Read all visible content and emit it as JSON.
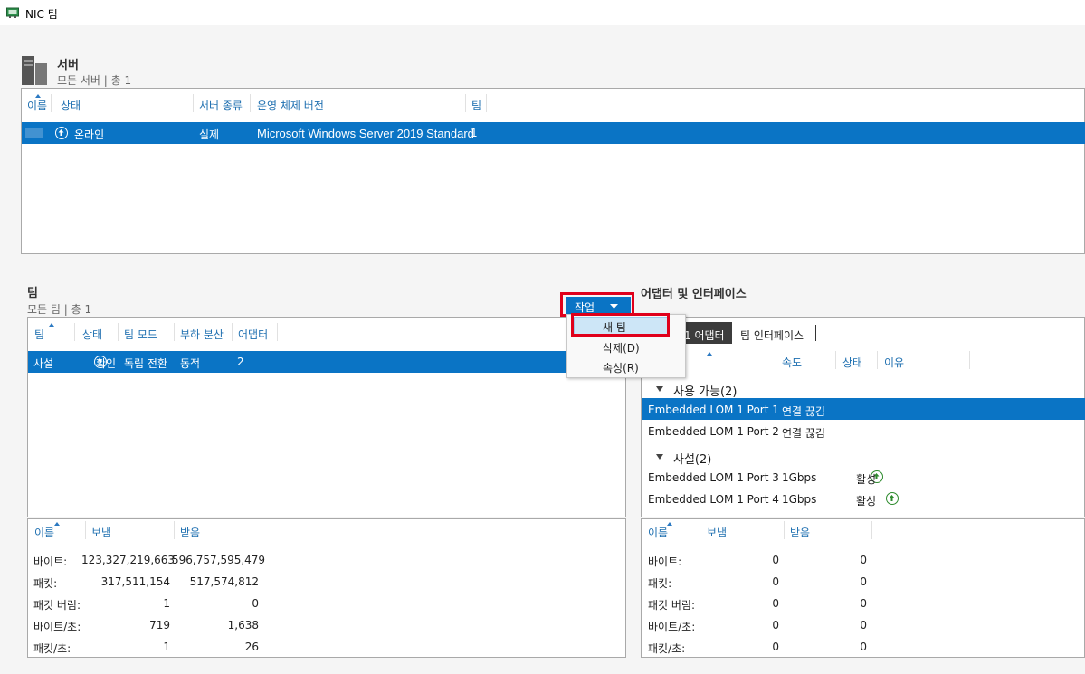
{
  "window": {
    "title": "NIC 팀"
  },
  "servers": {
    "title": "서버",
    "subtitle": "모든 서버 | 총 1",
    "columns": [
      "이름",
      "상태",
      "서버 종류",
      "운영 체제 버전",
      "팀"
    ],
    "row": {
      "status": "온라인",
      "type": "실제",
      "os": "Microsoft Windows Server 2019 Standard",
      "teams": "1"
    }
  },
  "teams": {
    "title": "팀",
    "subtitle": "모든 팀 | 총 1",
    "columns": [
      "팀",
      "상태",
      "팀 모드",
      "부하 분산",
      "어댑터"
    ],
    "row": {
      "name": "사설",
      "status": "확인",
      "mode": "독립 전환",
      "balancing": "동적",
      "adapters": "2"
    },
    "stats": {
      "columns": [
        "이름",
        "보냄",
        "받음"
      ],
      "rows": [
        {
          "label": "바이트:",
          "sent": "123,327,219,663",
          "recv": "596,757,595,479"
        },
        {
          "label": "패킷:",
          "sent": "317,511,154",
          "recv": "517,574,812"
        },
        {
          "label": "패킷 버림:",
          "sent": "1",
          "recv": "0"
        },
        {
          "label": "바이트/초:",
          "sent": "719",
          "recv": "1,638"
        },
        {
          "label": "패킷/초:",
          "sent": "1",
          "recv": "26"
        }
      ]
    }
  },
  "tasks": {
    "label": "작업",
    "menu": [
      "새 팀",
      "삭제(D)",
      "속성(R)"
    ]
  },
  "adapters": {
    "title": "어댑터 및 인터페이스",
    "tabs": [
      "1 어댑터",
      "팀 인터페이스"
    ],
    "columns": [
      "속도",
      "상태",
      "이유"
    ],
    "groups": [
      {
        "name": "사용 가능(2)",
        "items": [
          {
            "name": "Embedded LOM 1 Port 1",
            "speed": "연결 끊김",
            "state": ""
          },
          {
            "name": "Embedded LOM 1 Port 2",
            "speed": "연결 끊김",
            "state": ""
          }
        ]
      },
      {
        "name": "사설(2)",
        "items": [
          {
            "name": "Embedded LOM 1 Port 3",
            "speed": "1Gbps",
            "state": "활성"
          },
          {
            "name": "Embedded LOM 1 Port 4",
            "speed": "1Gbps",
            "state": "활성"
          }
        ]
      }
    ],
    "stats": {
      "columns": [
        "이름",
        "보냄",
        "받음"
      ],
      "rows": [
        {
          "label": "바이트:",
          "sent": "0",
          "recv": "0"
        },
        {
          "label": "패킷:",
          "sent": "0",
          "recv": "0"
        },
        {
          "label": "패킷 버림:",
          "sent": "0",
          "recv": "0"
        },
        {
          "label": "바이트/초:",
          "sent": "0",
          "recv": "0"
        },
        {
          "label": "패킷/초:",
          "sent": "0",
          "recv": "0"
        }
      ]
    }
  },
  "colors": {
    "accent": "#0a74c5",
    "highlight": "#e0001b",
    "ok": "#2e8b2e"
  }
}
